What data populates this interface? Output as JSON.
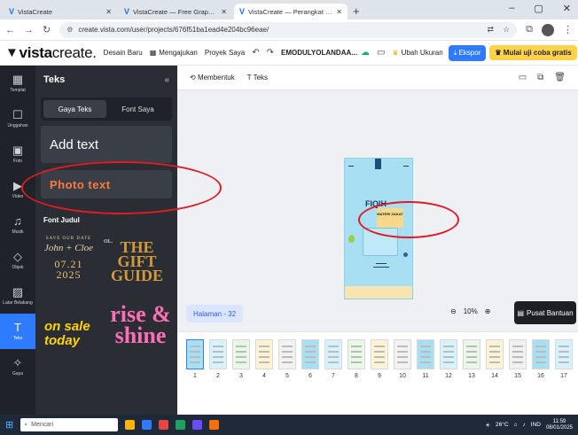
{
  "browser": {
    "tabs": [
      {
        "title": "VistaCreate",
        "close": "✕"
      },
      {
        "title": "VistaCreate — Free Graphic De",
        "close": "✕"
      },
      {
        "title": "VistaCreate — Perangkat Lunak",
        "close": "✕"
      }
    ],
    "new_tab": "+",
    "url": "create.vista.com/user/projects/676f51ba1ead4e204bc96eae/",
    "window_controls": [
      "–",
      "▢",
      "✕"
    ]
  },
  "header": {
    "brand_a": "vista",
    "brand_b": "create.",
    "desain_baru": "Desain Baru",
    "mengajukan": "Mengajukan",
    "proyek_saya": "Proyek Saya",
    "project_name": "EMODULYOLANDAA...",
    "ubah_ukuran": "Ubah Ukuran",
    "ekspor": "Ekspor",
    "mulai": "Mulai uji coba gratis",
    "avatar": "AM"
  },
  "rail": [
    {
      "icon": "▦",
      "label": "Templat"
    },
    {
      "icon": "☐",
      "label": "Unggahan"
    },
    {
      "icon": "▣",
      "label": "Foto"
    },
    {
      "icon": "▶",
      "label": "Video"
    },
    {
      "icon": "♫",
      "label": "Musik"
    },
    {
      "icon": "◇",
      "label": "Objek"
    },
    {
      "icon": "▨",
      "label": "Latar Belakang"
    },
    {
      "icon": "T",
      "label": "Teks"
    },
    {
      "icon": "✧",
      "label": "Gaya"
    }
  ],
  "panel": {
    "title": "Teks",
    "collapse": "«",
    "tab_gaya": "Gaya Teks",
    "tab_font": "Font Saya",
    "add_text": "Add text",
    "photo_text": "Photo text",
    "font_judul": "Font Judul",
    "tpl_save": "SAVE OUR DATE",
    "tpl_names": "John + Cloe",
    "tpl_date": "07.21 2025",
    "tpl_our": "OL.",
    "tpl_gift": "THE GIFT GUIDE",
    "tpl_onsale": "on sale today",
    "tpl_rise": "rise & shine"
  },
  "canvas": {
    "membentuk": "Membentuk",
    "teks": "Teks",
    "halaman": "Halaman - 32",
    "zoom": "10%",
    "help": "Pusat Bantuan",
    "poster_fiqih": "FIQIH",
    "poster_materi": "MATERI ZAKAT"
  },
  "pages": [
    "1",
    "2",
    "3",
    "4",
    "5",
    "6",
    "7",
    "8",
    "9",
    "10",
    "11",
    "12",
    "13",
    "14",
    "15",
    "16",
    "17"
  ],
  "taskbar": {
    "search": "Mencari",
    "weather": "26°C",
    "lang": "IND",
    "time": "11:59",
    "date": "08/01/2025"
  }
}
